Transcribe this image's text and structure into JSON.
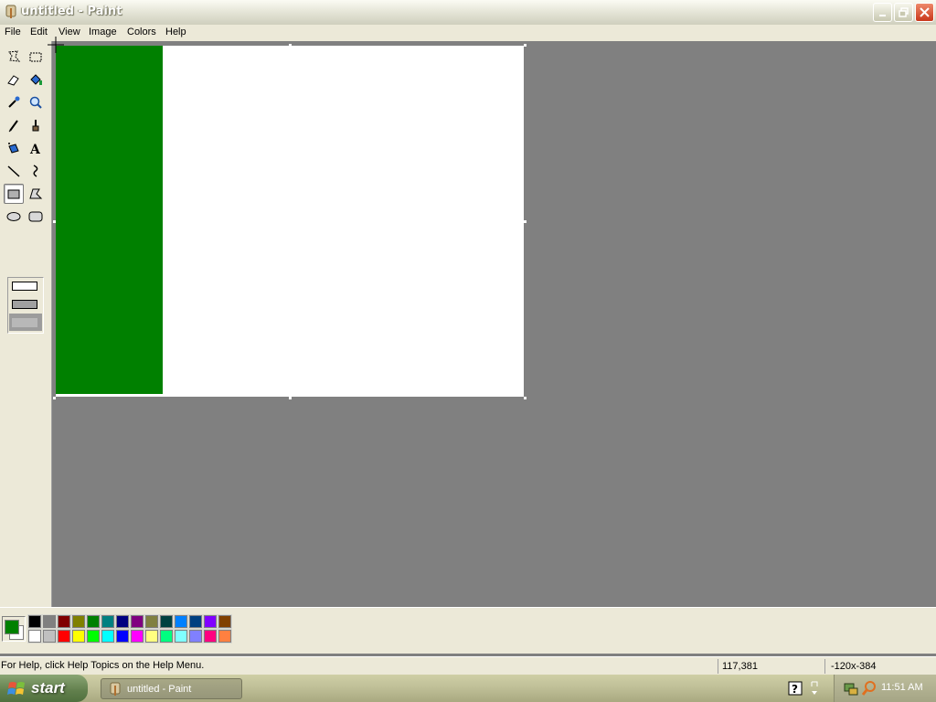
{
  "window": {
    "title": "untitled - Paint",
    "buttons": {
      "minimize": "minimize",
      "maximize": "restore",
      "close": "close"
    }
  },
  "menu": [
    "File",
    "Edit",
    "View",
    "Image",
    "Colors",
    "Help"
  ],
  "tools": [
    "free-form-select",
    "select",
    "eraser",
    "fill-with-color",
    "pick-color",
    "magnifier",
    "pencil",
    "brush",
    "airbrush",
    "text",
    "line",
    "curve",
    "rectangle",
    "polygon",
    "ellipse",
    "rounded-rectangle"
  ],
  "selected_tool": "rectangle",
  "fill_style_selected": 2,
  "canvas": {
    "background": "#FFFFFF",
    "stripe_color": "#008000"
  },
  "palette": {
    "foreground": "#008000",
    "background": "#FFFFFF",
    "top_row": [
      "#000000",
      "#808080",
      "#800000",
      "#808000",
      "#008000",
      "#008080",
      "#000080",
      "#800080",
      "#808040",
      "#004040",
      "#0080FF",
      "#004080",
      "#8000FF",
      "#804000"
    ],
    "bottom_row": [
      "#FFFFFF",
      "#C0C0C0",
      "#FF0000",
      "#FFFF00",
      "#00FF00",
      "#00FFFF",
      "#0000FF",
      "#FF00FF",
      "#FFFF80",
      "#00FF80",
      "#80FFFF",
      "#8080FF",
      "#FF0080",
      "#FF8040"
    ]
  },
  "status": {
    "help": "For Help, click Help Topics on the Help Menu.",
    "position": "117,381",
    "size": "-120x-384"
  },
  "taskbar": {
    "start_label": "start",
    "task_label": "untitled - Paint",
    "clock": "11:51 AM"
  }
}
